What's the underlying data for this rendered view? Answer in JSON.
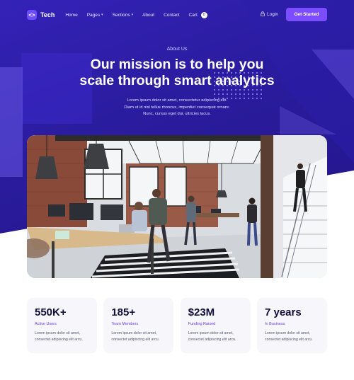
{
  "nav": {
    "logo_text": "Tech",
    "items": [
      {
        "label": "Home",
        "dropdown": false
      },
      {
        "label": "Pages",
        "dropdown": true
      },
      {
        "label": "Sections",
        "dropdown": true
      },
      {
        "label": "About",
        "dropdown": false
      },
      {
        "label": "Contact",
        "dropdown": false
      },
      {
        "label": "Cart",
        "dropdown": false
      }
    ],
    "cart_count": "0",
    "login_label": "Login",
    "cta_label": "Get Started"
  },
  "hero": {
    "eyebrow": "About Us",
    "headline_line1": "Our mission is to help you",
    "headline_line2": "scale through smart analytics",
    "subtext_line1": "Lorem ipsum dolor sit amet, consectetur adipiscing elit.",
    "subtext_line2": "Diam ut id nisl tellus rhoncus, imperdiet consequat ornare.",
    "subtext_line3": "Nunc, cursus eget dui, ultricies lacus."
  },
  "stats": [
    {
      "value": "550K+",
      "label": "Active Users",
      "desc_line1": "Lorem ipsum dolor sit amet,",
      "desc_line2": "consectet adipiscing elit arcu."
    },
    {
      "value": "185+",
      "label": "Team Members",
      "desc_line1": "Lorem ipsum dolor sit amet,",
      "desc_line2": "consectet adipiscing elit arcu."
    },
    {
      "value": "$23M",
      "label": "Funding Raised",
      "desc_line1": "Lorem ipsum dolor sit amet,",
      "desc_line2": "consectet adipiscing elit arcu."
    },
    {
      "value": "7 years",
      "label": "In Business",
      "desc_line1": "Lorem ipsum dolor sit amet,",
      "desc_line2": "consectet adipiscing elit arcu."
    }
  ],
  "colors": {
    "hero_bg": "#2a1c9e",
    "accent": "#7c4dff",
    "stat_label": "#6b3df5"
  },
  "icons": {
    "logo": "code-brackets-icon",
    "login": "lock-icon",
    "dropdown": "chevron-down-icon"
  }
}
